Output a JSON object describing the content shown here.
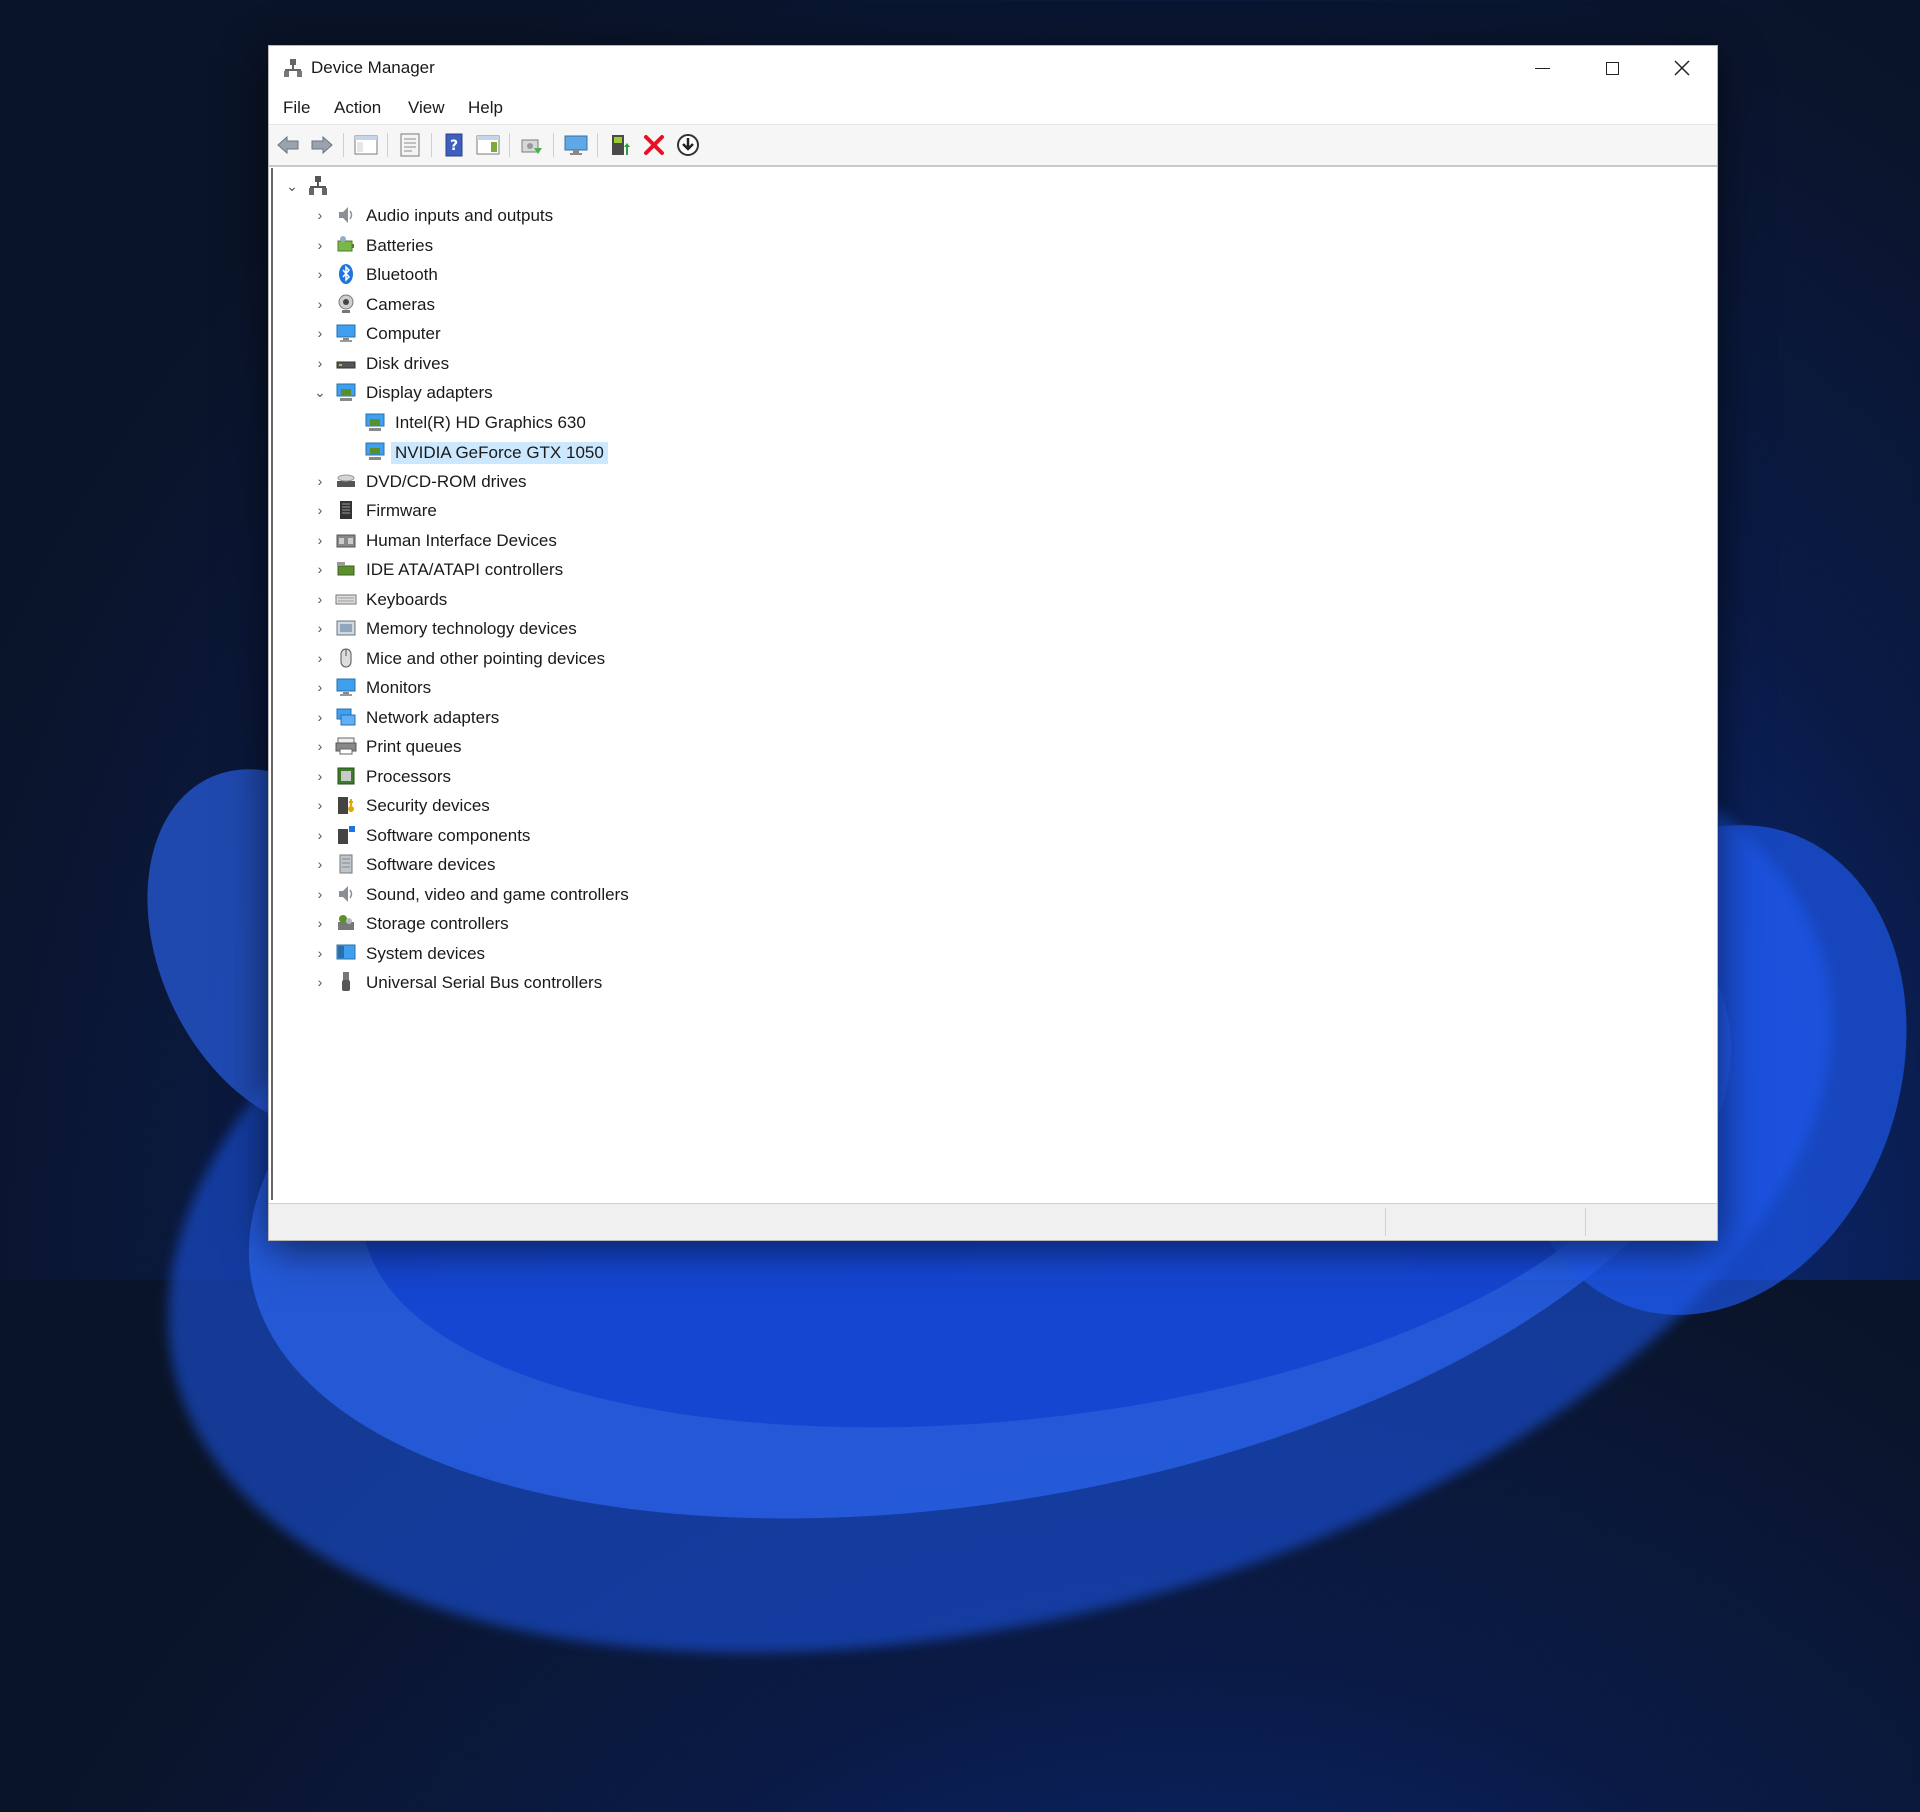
{
  "window": {
    "title": "Device Manager"
  },
  "menu": {
    "file": "File",
    "action": "Action",
    "view": "View",
    "help": "Help"
  },
  "tree": {
    "categories": [
      "Audio inputs and outputs",
      "Batteries",
      "Bluetooth",
      "Cameras",
      "Computer",
      "Disk drives",
      "Display adapters",
      "DVD/CD-ROM drives",
      "Firmware",
      "Human Interface Devices",
      "IDE ATA/ATAPI controllers",
      "Keyboards",
      "Memory technology devices",
      "Mice and other pointing devices",
      "Monitors",
      "Network adapters",
      "Print queues",
      "Processors",
      "Security devices",
      "Software components",
      "Software devices",
      "Sound, video and game controllers",
      "Storage controllers",
      "System devices",
      "Universal Serial Bus controllers"
    ],
    "display_children": [
      "Intel(R) HD Graphics 630",
      "NVIDIA GeForce GTX 1050"
    ],
    "selected": "NVIDIA GeForce GTX 1050",
    "expanded": "Display adapters"
  },
  "colors": {
    "selection": "#cce8ff",
    "accent": "#0078d4",
    "error_red": "#e81123"
  }
}
